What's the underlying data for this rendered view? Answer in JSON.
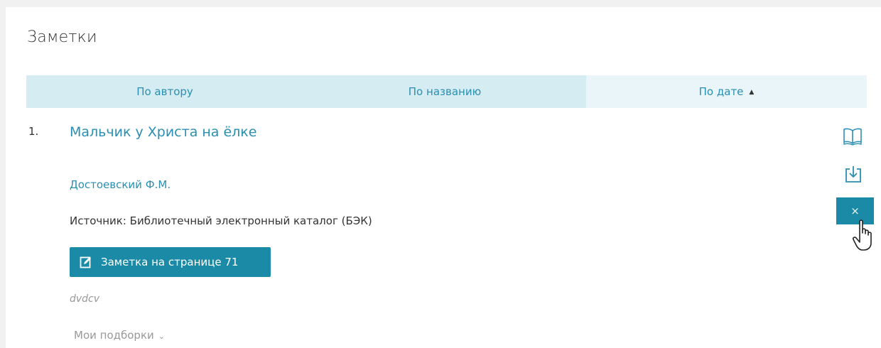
{
  "page": {
    "title": "Заметки"
  },
  "sort": {
    "by_author": "По автору",
    "by_title": "По названию",
    "by_date": "По дате",
    "active": "by_date",
    "direction": "asc"
  },
  "items": [
    {
      "number": "1.",
      "title": "Мальчик у Христа на ёлке",
      "author": "Достоевский Ф.М.",
      "source": "Источник: Библиотечный электронный каталог (БЭК)",
      "note_button": "Заметка на странице 71",
      "note_text": "dvdcv",
      "collections": "Мои подборки",
      "delete_label": "×"
    }
  ],
  "icons": {
    "read": "open-book-icon",
    "download": "download-icon",
    "note": "edit-note-icon",
    "collections_chevron": "chevron-down-icon"
  },
  "colors": {
    "accent": "#1a8aa6",
    "link": "#2a8fb2",
    "sort_bar": "#d6ecf3"
  }
}
